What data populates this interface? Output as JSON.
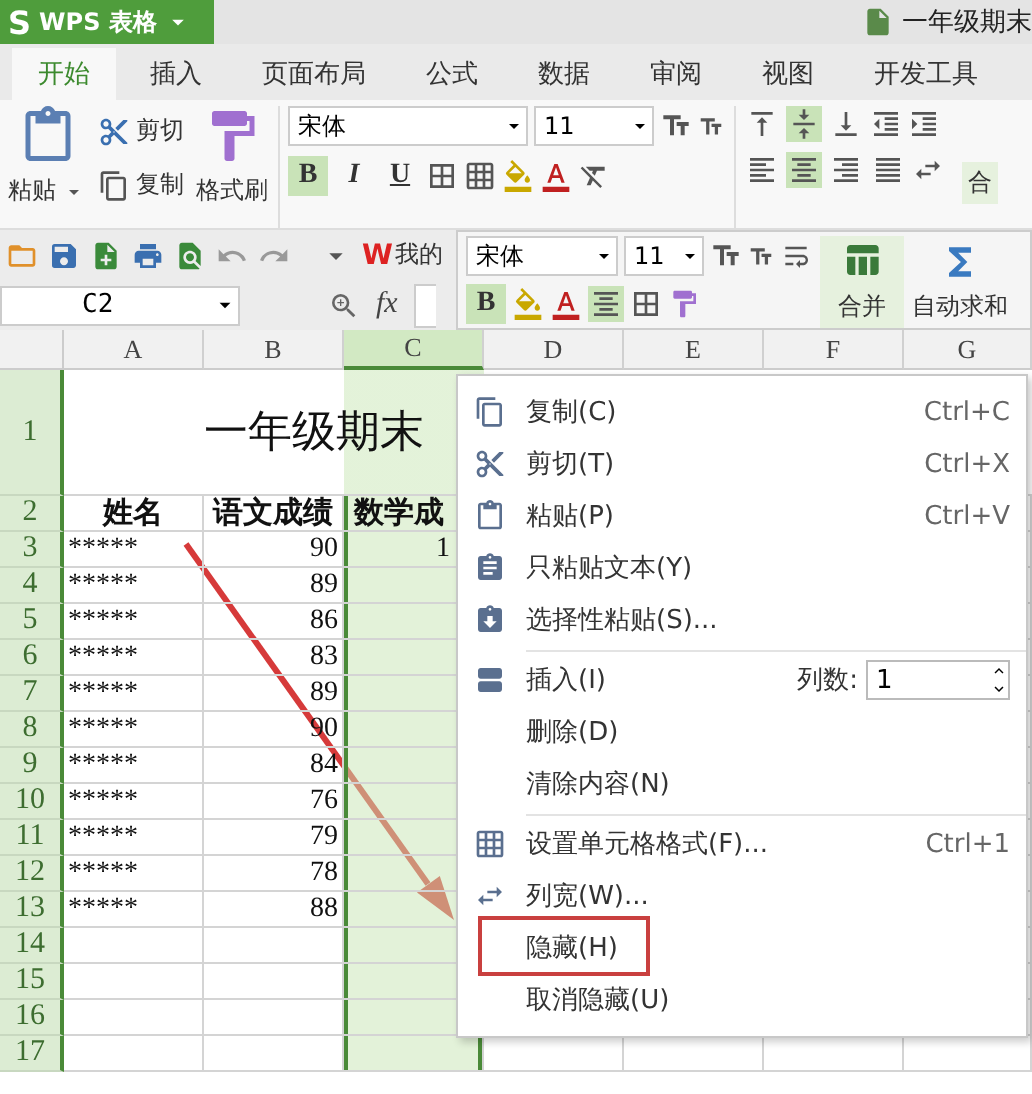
{
  "app_button": {
    "logo": "S",
    "label": "WPS 表格"
  },
  "document_title": "一年级期末",
  "tabs": [
    {
      "label": "开始",
      "selected": true
    },
    {
      "label": "插入",
      "selected": false
    },
    {
      "label": "页面布局",
      "selected": false
    },
    {
      "label": "公式",
      "selected": false
    },
    {
      "label": "数据",
      "selected": false
    },
    {
      "label": "审阅",
      "selected": false
    },
    {
      "label": "视图",
      "selected": false
    },
    {
      "label": "开发工具",
      "selected": false
    }
  ],
  "ribbon": {
    "paste": "粘贴",
    "cut": "剪切",
    "copy": "复制",
    "painter": "格式刷",
    "font": "宋体",
    "size": "11",
    "styles": [
      {
        "label": "B",
        "selected": true
      },
      {
        "label": "I",
        "selected": false
      },
      {
        "label": "U",
        "selected": false
      }
    ],
    "vertical_align": [
      {
        "selected": false
      },
      {
        "selected": true
      },
      {
        "selected": false
      }
    ],
    "horizontal_align": [
      {
        "selected": false
      },
      {
        "selected": true
      },
      {
        "selected": false
      },
      {
        "selected": false
      }
    ],
    "merge_cut": "合"
  },
  "quick_access": {
    "logo": "W",
    "label": "我的"
  },
  "mini_toolbar": {
    "font": "宋体",
    "size": "11",
    "bold": {
      "label": "B",
      "selected": true
    },
    "align_selected": true,
    "merge": "合并",
    "autosum": "自动求和"
  },
  "name_box": "C2",
  "fx": "fx",
  "columns": [
    {
      "label": "A",
      "selected": false
    },
    {
      "label": "B",
      "selected": false
    },
    {
      "label": "C",
      "selected": true
    },
    {
      "label": "D",
      "selected": false
    },
    {
      "label": "E",
      "selected": false
    },
    {
      "label": "F",
      "selected": false
    },
    {
      "label": "G",
      "selected": false
    }
  ],
  "title_row": {
    "header": "1",
    "text": "一年级期末"
  },
  "rows": [
    {
      "header": "2",
      "kind": "heading",
      "cells": [
        "姓名",
        "语文成绩",
        "数学成"
      ]
    },
    {
      "header": "3",
      "kind": "data",
      "cells": [
        "*****",
        "90",
        "1"
      ]
    },
    {
      "header": "4",
      "kind": "data",
      "cells": [
        "*****",
        "89"
      ]
    },
    {
      "header": "5",
      "kind": "data",
      "cells": [
        "*****",
        "86"
      ]
    },
    {
      "header": "6",
      "kind": "data",
      "cells": [
        "*****",
        "83"
      ]
    },
    {
      "header": "7",
      "kind": "data",
      "cells": [
        "*****",
        "89"
      ]
    },
    {
      "header": "8",
      "kind": "data",
      "cells": [
        "*****",
        "90"
      ]
    },
    {
      "header": "9",
      "kind": "data",
      "cells": [
        "*****",
        "84"
      ]
    },
    {
      "header": "10",
      "kind": "data",
      "cells": [
        "*****",
        "76"
      ]
    },
    {
      "header": "11",
      "kind": "data",
      "cells": [
        "*****",
        "79"
      ]
    },
    {
      "header": "12",
      "kind": "data",
      "cells": [
        "*****",
        "78"
      ]
    },
    {
      "header": "13",
      "kind": "data",
      "cells": [
        "*****",
        "88"
      ]
    },
    {
      "header": "14",
      "kind": "data",
      "cells": []
    },
    {
      "header": "15",
      "kind": "data",
      "cells": []
    },
    {
      "header": "16",
      "kind": "data",
      "cells": []
    },
    {
      "header": "17",
      "kind": "data",
      "cells": []
    }
  ],
  "context_menu": [
    {
      "kind": "item",
      "label": "复制(C)",
      "shortcut": "Ctrl+C",
      "marked": false
    },
    {
      "kind": "item",
      "label": "剪切(T)",
      "shortcut": "Ctrl+X",
      "marked": false
    },
    {
      "kind": "item",
      "label": "粘贴(P)",
      "shortcut": "Ctrl+V",
      "marked": false
    },
    {
      "kind": "item",
      "label": "只粘贴文本(Y)",
      "marked": false
    },
    {
      "kind": "item",
      "label": "选择性粘贴(S)...",
      "marked": false
    },
    {
      "kind": "separator"
    },
    {
      "kind": "count",
      "label": "插入(I)",
      "count_label": "列数:",
      "count": "1",
      "marked": false
    },
    {
      "kind": "item",
      "label": "删除(D)",
      "marked": false
    },
    {
      "kind": "item",
      "label": "清除内容(N)",
      "marked": false
    },
    {
      "kind": "separator"
    },
    {
      "kind": "item",
      "label": "设置单元格格式(F)...",
      "shortcut": "Ctrl+1",
      "marked": false
    },
    {
      "kind": "item",
      "label": "列宽(W)...",
      "marked": false
    },
    {
      "kind": "item",
      "label": "隐藏(H)",
      "marked": true
    },
    {
      "kind": "item",
      "label": "取消隐藏(U)",
      "marked": false
    }
  ]
}
